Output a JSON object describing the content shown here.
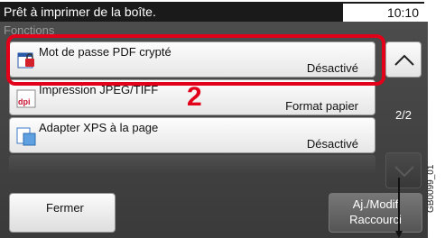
{
  "status": {
    "message": "Prêt à imprimer de la boîte.",
    "time": "10:10"
  },
  "panel": {
    "header": "Fonctions"
  },
  "items": [
    {
      "label": "Mot de passe PDF crypté",
      "value": "Désactivé",
      "icon": "pdf-lock-icon"
    },
    {
      "label": "Impression JPEG/TIFF",
      "value": "Format papier",
      "icon": "dpi-icon"
    },
    {
      "label": "Adapter XPS à la page",
      "value": "Désactivé",
      "icon": "xps-icon"
    }
  ],
  "pagination": {
    "indicator": "2/2"
  },
  "annotation": {
    "step": "2",
    "highlight_color": "#e2001a"
  },
  "buttons": {
    "close": "Fermer",
    "shortcut_line1": "Aj./Modif",
    "shortcut_line2": "Raccourci"
  },
  "figure_code": "GB0099_01"
}
